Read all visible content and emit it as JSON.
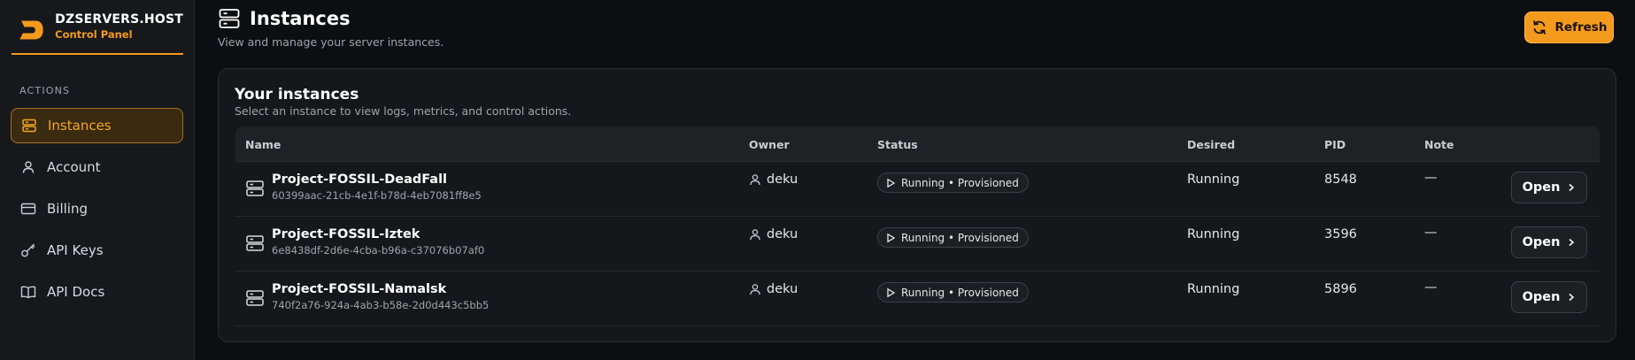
{
  "brand": {
    "title": "DZSERVERS.HOST",
    "subtitle": "Control Panel"
  },
  "sidebar": {
    "section_label": "ACTIONS",
    "items": [
      {
        "label": "Instances",
        "icon": "server-icon",
        "active": true
      },
      {
        "label": "Account",
        "icon": "user-icon",
        "active": false
      },
      {
        "label": "Billing",
        "icon": "credit-card-icon",
        "active": false
      },
      {
        "label": "API Keys",
        "icon": "key-icon",
        "active": false
      },
      {
        "label": "API Docs",
        "icon": "book-icon",
        "active": false
      }
    ]
  },
  "header": {
    "title": "Instances",
    "subtitle": "View and manage your server instances.",
    "refresh_label": "Refresh"
  },
  "card": {
    "title": "Your instances",
    "subtitle": "Select an instance to view logs, metrics, and control actions."
  },
  "table": {
    "columns": [
      "Name",
      "Owner",
      "Status",
      "Desired",
      "PID",
      "Note"
    ],
    "rows": [
      {
        "name": "Project-FOSSIL-DeadFall",
        "uuid": "60399aac-21cb-4e1f-b78d-4eb7081ff8e5",
        "owner": "deku",
        "status": "Running • Provisioned",
        "desired": "Running",
        "pid": "8548",
        "note": "—",
        "action": "Open"
      },
      {
        "name": "Project-FOSSIL-Iztek",
        "uuid": "6e8438df-2d6e-4cba-b96a-c37076b07af0",
        "owner": "deku",
        "status": "Running • Provisioned",
        "desired": "Running",
        "pid": "3596",
        "note": "—",
        "action": "Open"
      },
      {
        "name": "Project-FOSSIL-Namalsk",
        "uuid": "740f2a76-924a-4ab3-b58e-2d0d443c5bb5",
        "owner": "deku",
        "status": "Running • Provisioned",
        "desired": "Running",
        "pid": "5896",
        "note": "—",
        "action": "Open"
      }
    ]
  },
  "colors": {
    "accent": "#f49a1d",
    "background": "#0d0e11",
    "sidebar": "#17181c",
    "card": "#16171b"
  }
}
